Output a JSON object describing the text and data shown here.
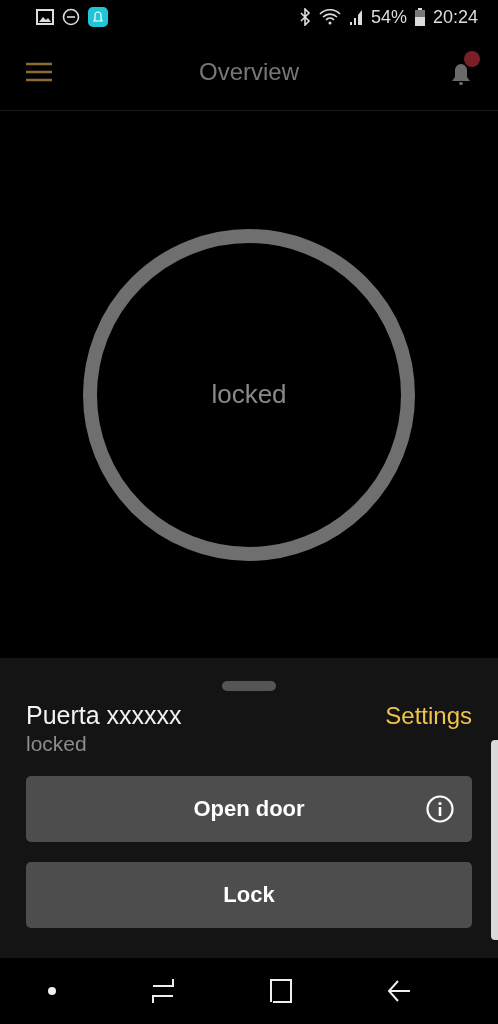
{
  "status_bar": {
    "battery": "54%",
    "time": "20:24"
  },
  "app_bar": {
    "title": "Overview",
    "notification_badge": true
  },
  "lock_ring": {
    "status": "locked"
  },
  "device_sheet": {
    "name": "Puerta xxxxxx",
    "status": "locked",
    "settings_link": "Settings",
    "buttons": [
      {
        "label": "Open door",
        "info": true
      },
      {
        "label": "Lock",
        "info": false
      }
    ]
  }
}
